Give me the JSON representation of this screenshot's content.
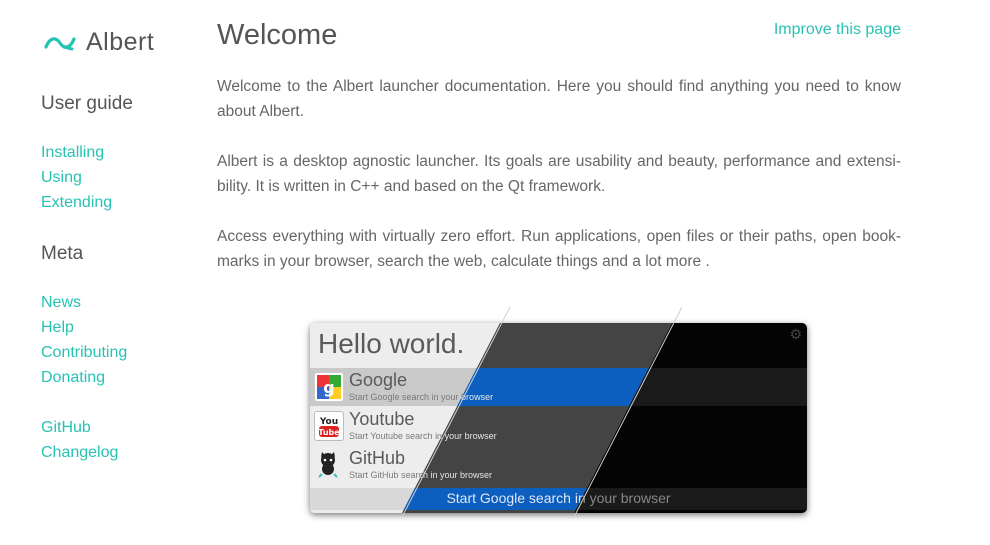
{
  "sidebar": {
    "brand_name": "Albert",
    "sections": [
      {
        "title": "User guide",
        "items": [
          "Installing",
          "Using",
          "Extending"
        ]
      },
      {
        "title": "Meta",
        "items": [
          "News",
          "Help",
          "Contributing",
          "Donating"
        ]
      }
    ],
    "extra_items": [
      "GitHub",
      "Changelog"
    ]
  },
  "main": {
    "title": "Welcome",
    "improve_link": "Improve this page",
    "paragraphs": [
      "Welcome to the Albert launcher documentation. Here you should find anything you need to know about Albert.",
      "Albert is a desktop agnostic launcher. Its goals are usability and beauty, performance and extensi-bility. It is written in C++ and based on the Qt framework.",
      "Access everything with virtually zero effort. Run applications, open files or their paths, open book-marks in your browser, search the web, calculate things and a lot more ."
    ]
  },
  "launcher": {
    "query": "Hello world.",
    "gear_icon": "gear-icon",
    "results": [
      {
        "icon": "google-icon",
        "title": "Google",
        "subtitle": "Start Google search in your browser"
      },
      {
        "icon": "youtube-icon",
        "title": "Youtube",
        "subtitle": "Start Youtube search in your browser"
      },
      {
        "icon": "github-icon",
        "title": "GitHub",
        "subtitle": "Start GitHub search in your browser"
      }
    ],
    "footer": "Start Google search in your browser"
  },
  "colors": {
    "accent": "#26c3b3",
    "selection": "#0d5fbf"
  }
}
